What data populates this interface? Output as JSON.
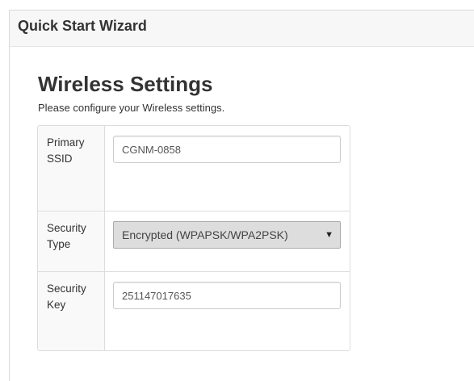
{
  "wizard": {
    "title": "Quick Start Wizard"
  },
  "section": {
    "title": "Wireless Settings",
    "description": "Please configure your Wireless settings."
  },
  "form": {
    "primary_ssid": {
      "label": "Primary SSID",
      "value": "CGNM-0858"
    },
    "security_type": {
      "label": "Security Type",
      "selected": "Encrypted (WPAPSK/WPA2PSK)"
    },
    "security_key": {
      "label": "Security Key",
      "value": "251147017635"
    }
  },
  "icons": {
    "dropdown": "chevron-down-icon"
  }
}
